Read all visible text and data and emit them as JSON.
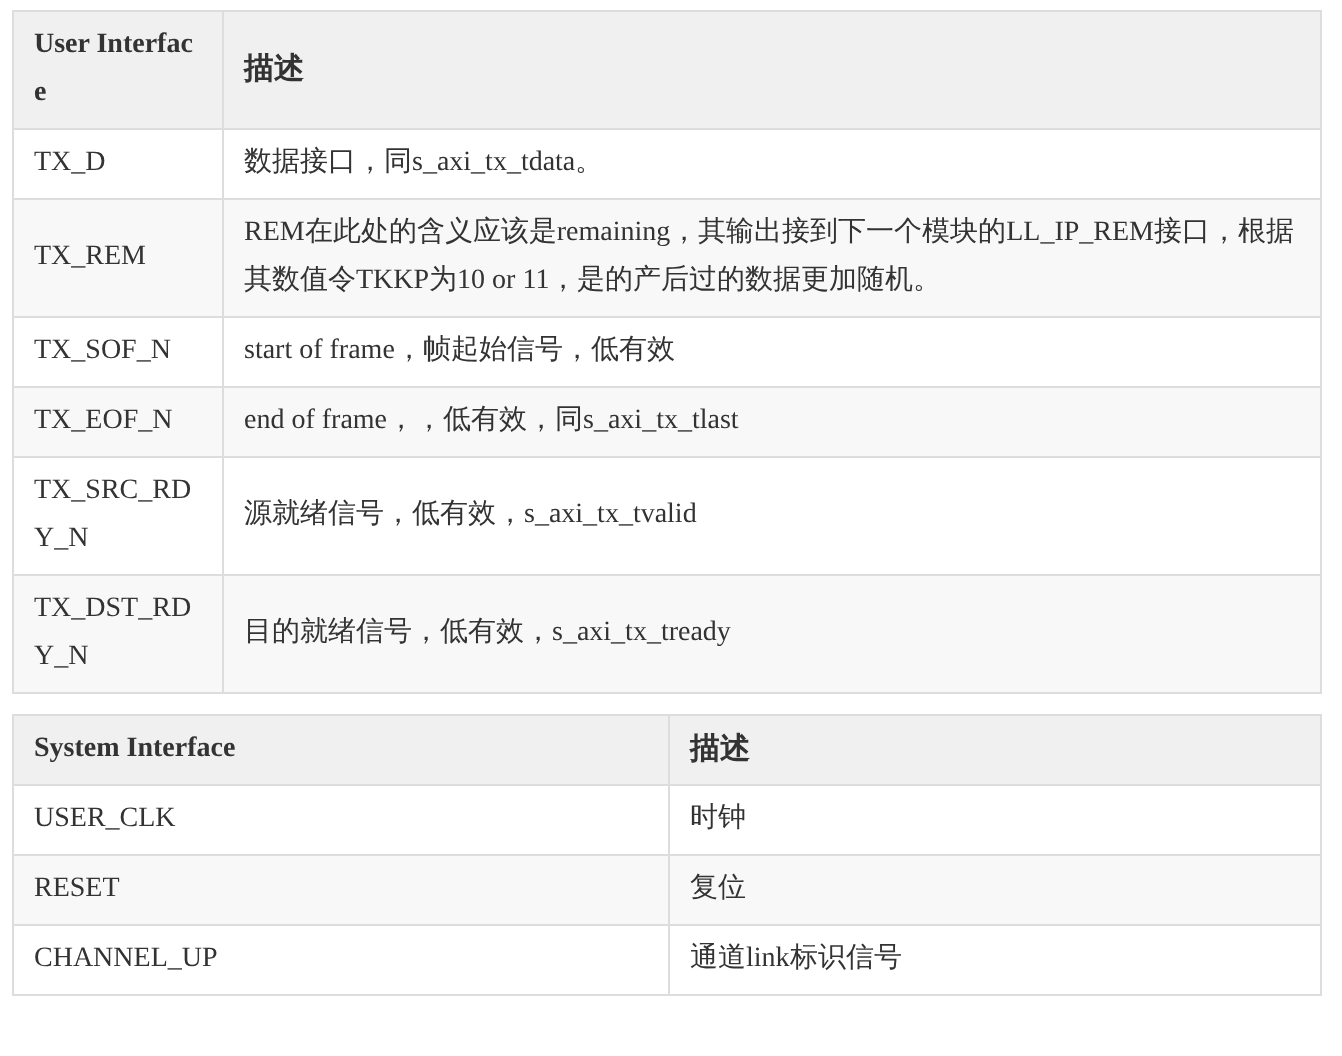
{
  "tables": [
    {
      "columns": [
        "User Interface",
        "描述"
      ],
      "rows": [
        [
          "TX_D",
          "数据接口，同s_axi_tx_tdata。"
        ],
        [
          "TX_REM",
          "REM在此处的含义应该是remaining，其输出接到下一个模块的LL_IP_REM接口，根据其数值令TKKP为10 or 11，是的产后过的数据更加随机。"
        ],
        [
          "TX_SOF_N",
          "start of frame，帧起始信号，低有效"
        ],
        [
          "TX_EOF_N",
          "end of frame，，低有效，同s_axi_tx_tlast"
        ],
        [
          "TX_SRC_RDY_N",
          "源就绪信号，低有效，s_axi_tx_tvalid"
        ],
        [
          "TX_DST_RDY_N",
          "目的就绪信号，低有效，s_axi_tx_tready"
        ]
      ]
    },
    {
      "columns": [
        "System Interface",
        "描述"
      ],
      "rows": [
        [
          "USER_CLK",
          "时钟"
        ],
        [
          "RESET",
          "复位"
        ],
        [
          "CHANNEL_UP",
          "通道link标识信号"
        ]
      ]
    }
  ]
}
